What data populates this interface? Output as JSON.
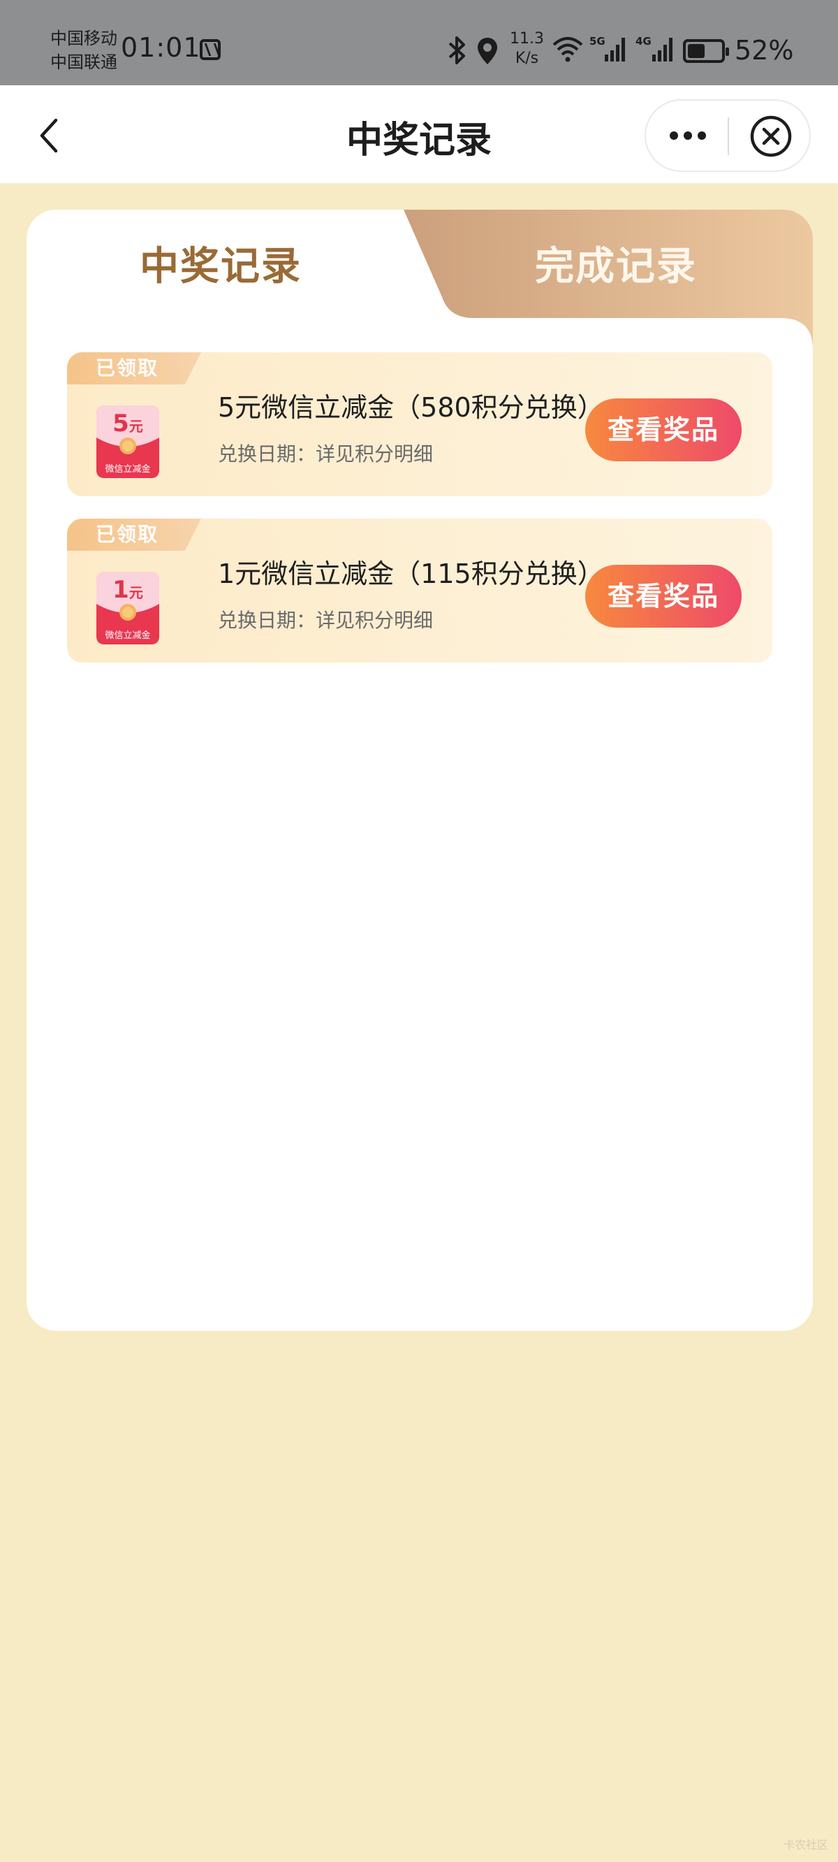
{
  "status_bar": {
    "carrier_1": "中国移动",
    "carrier_2": "中国联通",
    "time": "01:01",
    "net_speed_value": "11.3",
    "net_speed_unit": "K/s",
    "signal_1_label": "5G",
    "signal_2_label": "4G",
    "battery_percent": "52%",
    "battery_level": 0.52
  },
  "nav": {
    "title": "中奖记录"
  },
  "tabs": [
    {
      "label": "中奖记录",
      "active": true
    },
    {
      "label": "完成记录",
      "active": false
    }
  ],
  "records": [
    {
      "tag": "已领取",
      "envelope_amount": "5",
      "envelope_unit": "元",
      "envelope_label": "微信立减金",
      "title": "5元微信立减金（580积分兑换）",
      "date_text": "兑换日期：详见积分明细",
      "button": "查看奖品"
    },
    {
      "tag": "已领取",
      "envelope_amount": "1",
      "envelope_unit": "元",
      "envelope_label": "微信立减金",
      "title": "1元微信立减金（115积分兑换）",
      "date_text": "兑换日期：详见积分明细",
      "button": "查看奖品"
    }
  ],
  "watermark": "卡农社区",
  "colors": {
    "page_bg": "#f6ebc4",
    "active_tab": "#9a6a36",
    "button_start": "#f7893e",
    "button_end": "#ee4a6a",
    "envelope_red": "#e0354c"
  }
}
